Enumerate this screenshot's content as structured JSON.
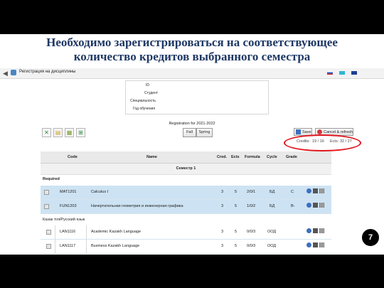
{
  "slide": {
    "heading_line1": "Необходимо зарегистрироваться на соответствующее",
    "heading_line2": "количество кредитов выбранного семестра",
    "page_number": "7"
  },
  "app": {
    "back_icon": "back-arrow-icon",
    "title": "Регистрация на дисциплины",
    "language_flags": [
      "ru-flag-icon",
      "kz-flag-icon",
      "en-flag-icon"
    ]
  },
  "student_info": {
    "labels": [
      "ID",
      "Студент",
      "Специальность",
      "Год обучения"
    ]
  },
  "registration": {
    "title": "Registration for 2021-2022",
    "semesters": [
      "Fall",
      "Spring"
    ],
    "save_label": "Save",
    "cancel_label": "Cancel & refresh",
    "credits_label": "Credits:",
    "credits_value": "19 / 16",
    "ects_label": "Ects:",
    "ects_value": "32 / 27",
    "highlight_color": "#e0161d"
  },
  "table": {
    "columns": [
      "Code",
      "Name",
      "Cred.",
      "Ects",
      "Formula",
      "Cycle",
      "Grade"
    ],
    "semester": "Семестр 1",
    "required_label": "Required",
    "group_label": "Казак тілі/Русский язык",
    "rows": [
      {
        "code": "MAT1201",
        "name": "Calculus I",
        "cred": "3",
        "ects": "5",
        "formula": "2/0/1",
        "cycle": "БД",
        "grade": "C",
        "selected": true
      },
      {
        "code": "FUN1203",
        "name": "Начертательная геометрия и инженерная графика",
        "cred": "3",
        "ects": "5",
        "formula": "1/0/2",
        "cycle": "БД",
        "grade": "B-",
        "selected": true
      },
      {
        "code": "LAN1116",
        "name": "Academic Kazakh Language",
        "cred": "3",
        "ects": "5",
        "formula": "0/0/3",
        "cycle": "ООД",
        "grade": "",
        "selected": false
      },
      {
        "code": "LAN1117",
        "name": "Business Kazakh Language",
        "cred": "3",
        "ects": "5",
        "formula": "0/0/3",
        "cycle": "ООД",
        "grade": "",
        "selected": false
      }
    ]
  }
}
